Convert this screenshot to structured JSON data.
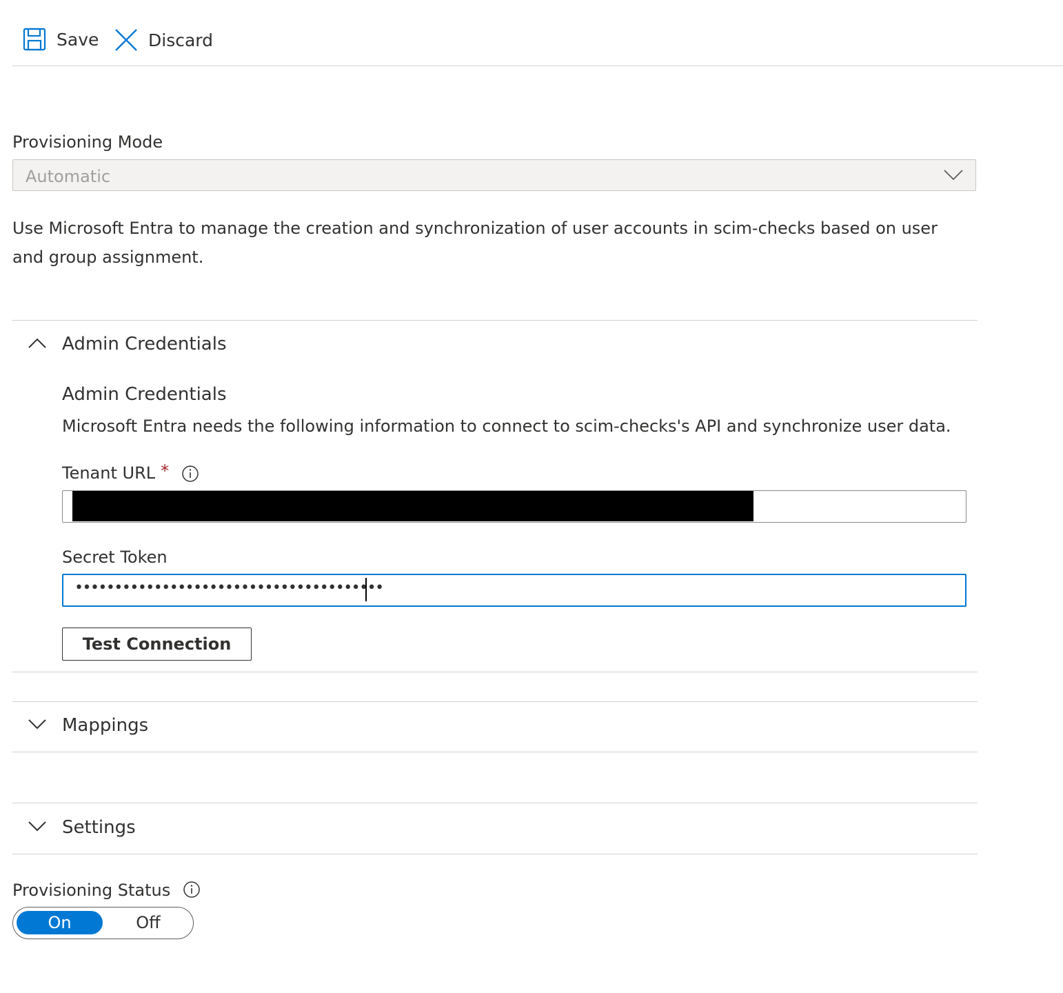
{
  "toolbar": {
    "save_label": "Save",
    "discard_label": "Discard",
    "save_icon": "save-icon",
    "discard_icon": "close-icon"
  },
  "provisioning_mode": {
    "label": "Provisioning Mode",
    "value": "Automatic"
  },
  "description": "Use Microsoft Entra to manage the creation and synchronization of user accounts in scim-checks based on user and group assignment.",
  "admin_credentials": {
    "section_title": "Admin Credentials",
    "heading": "Admin Credentials",
    "subtitle": "Microsoft Entra needs the following information to connect to scim-checks's API and synchronize user data.",
    "tenant_url_label": "Tenant URL",
    "required_marker": "*",
    "secret_token_label": "Secret Token",
    "secret_token_value": "•••••••••••••••••••••••••••••••••••••••",
    "test_connection_label": "Test Connection"
  },
  "mappings": {
    "section_title": "Mappings"
  },
  "settings": {
    "section_title": "Settings"
  },
  "provisioning_status": {
    "label": "Provisioning Status",
    "on_label": "On",
    "off_label": "Off",
    "selected": "On"
  },
  "colors": {
    "accent": "#0078d4",
    "text": "#323130",
    "required": "#a4262c"
  }
}
